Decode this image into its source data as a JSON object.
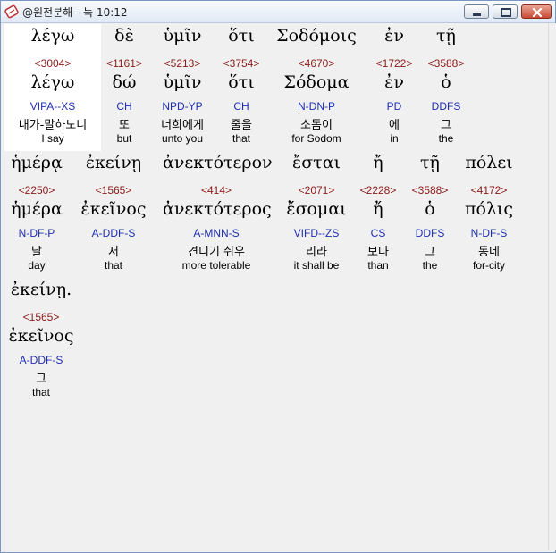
{
  "window": {
    "title": "@원전분해 - 눅 10:12"
  },
  "interlinear": [
    [
      {
        "greek": "λέγω",
        "strong": "<3004>",
        "lemma": "λέγω",
        "parse": "VIPA--XS",
        "korean": "내가-말하노니",
        "english": "I say"
      },
      {
        "greek": "δὲ",
        "strong": "<1161>",
        "lemma": "δώ",
        "parse": "CH",
        "korean": "또",
        "english": "but"
      },
      {
        "greek": "ὑμῖν",
        "strong": "<5213>",
        "lemma": "ὑμῖν",
        "parse": "NPD-YP",
        "korean": "너희에게",
        "english": "unto you"
      },
      {
        "greek": "ὅτι",
        "strong": "<3754>",
        "lemma": "ὅτι",
        "parse": "CH",
        "korean": "줄을",
        "english": "that"
      },
      {
        "greek": "Σοδόμοις",
        "strong": "<4670>",
        "lemma": "Σόδομα",
        "parse": "N-DN-P",
        "korean": "소돔이",
        "english": "for Sodom"
      },
      {
        "greek": "ἐν",
        "strong": "<1722>",
        "lemma": "ἐν",
        "parse": "PD",
        "korean": "에",
        "english": "in"
      },
      {
        "greek": "τῇ",
        "strong": "<3588>",
        "lemma": "ὁ",
        "parse": "DDFS",
        "korean": "그",
        "english": "the"
      }
    ],
    [
      {
        "greek": "ἡμέρᾳ",
        "strong": "<2250>",
        "lemma": "ἡμέρα",
        "parse": "N-DF-P",
        "korean": "날",
        "english": "day"
      },
      {
        "greek": "ἐκείνῃ",
        "strong": "<1565>",
        "lemma": "ἐκεῖνος",
        "parse": "A-DDF-S",
        "korean": "저",
        "english": "that"
      },
      {
        "greek": "ἀνεκτότερον",
        "strong": "<414>",
        "lemma": "ἀνεκτότερος",
        "parse": "A-MNN-S",
        "korean": "견디기 쉬우",
        "english": "more tolerable"
      },
      {
        "greek": "ἔσται",
        "strong": "<2071>",
        "lemma": "ἔσομαι",
        "parse": "VIFD--ZS",
        "korean": "리라",
        "english": "it shall be"
      },
      {
        "greek": "ἤ",
        "strong": "<2228>",
        "lemma": "ἤ",
        "parse": "CS",
        "korean": "보다",
        "english": "than"
      },
      {
        "greek": "τῇ",
        "strong": "<3588>",
        "lemma": "ὁ",
        "parse": "DDFS",
        "korean": "그",
        "english": "the"
      },
      {
        "greek": "πόλει",
        "strong": "<4172>",
        "lemma": "πόλις",
        "parse": "N-DF-S",
        "korean": "동네",
        "english": "for-city"
      }
    ],
    [
      {
        "greek": "ἐκείνῃ.",
        "strong": "<1565>",
        "lemma": "ἐκεῖνος",
        "parse": "A-DDF-S",
        "korean": "그",
        "english": "that"
      }
    ]
  ],
  "colors": {
    "strong": "#8b1a1a",
    "parse": "#1f2fb0",
    "greek": "#000000"
  }
}
